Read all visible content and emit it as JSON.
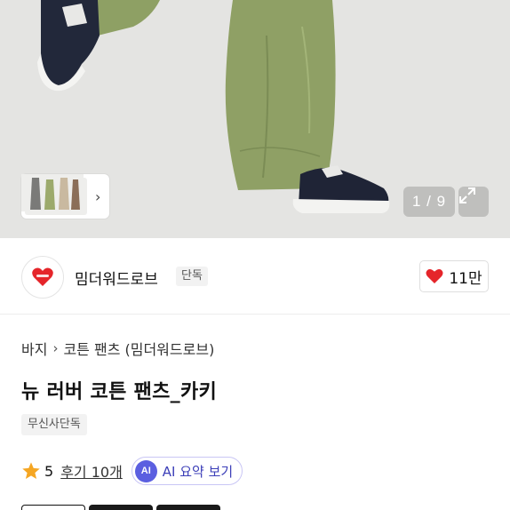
{
  "gallery": {
    "pager": "1 / 9",
    "icons": {
      "thumbnail_next": "chevron-right-icon",
      "expand": "expand-arrows-icon"
    }
  },
  "brand": {
    "name": "밈더워드로브",
    "badge": "단독",
    "logo_icon": "heart-logo-icon",
    "logo_color": "#e5252a",
    "like_count": "11만",
    "like_icon": "heart-icon",
    "like_color": "#e5252a"
  },
  "breadcrumb": [
    "바지",
    "코튼 팬츠 (밈더워드로브)"
  ],
  "product": {
    "title": "뉴 러버 코튼 팬츠_카키",
    "tag": "무신사단독"
  },
  "rating": {
    "score": "5",
    "review_link": "후기 10개",
    "star_color": "#f5a623"
  },
  "ai_summary": {
    "badge": "AI",
    "label": "AI 요약 보기",
    "accent": "#5b5fe0"
  }
}
